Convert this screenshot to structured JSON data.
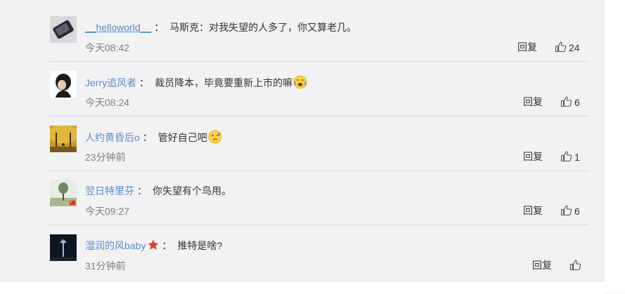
{
  "comments": [
    {
      "username": "__helloworld__",
      "text": "马斯克：对我失望的人多了，你又算老几。",
      "time": "今天08:42",
      "reply_label": "回复",
      "likes": "24",
      "avatar_icon": "phone-avatar-icon"
    },
    {
      "username": "Jerry追风者",
      "text": "裁员降本，毕竟要重新上市的嘛",
      "time": "今天08:24",
      "reply_label": "回复",
      "likes": "6",
      "emoji": "crying-laughing-emoji-icon",
      "avatar_icon": "profile-portrait-avatar-icon"
    },
    {
      "username": "人约黄昏后o",
      "text": "管好自己吧",
      "time": "23分钟前",
      "reply_label": "回复",
      "likes": "1",
      "emoji": "sweat-emoji-icon",
      "avatar_icon": "autumn-trees-avatar-icon"
    },
    {
      "username": "翌日特里芬",
      "text": "你失望有个鸟用。",
      "time": "今天09:27",
      "reply_label": "回复",
      "likes": "6",
      "avatar_icon": "tree-landscape-avatar-icon"
    },
    {
      "username": "湿润的风baby",
      "text": "推特是啥?",
      "time": "31分钟前",
      "reply_label": "回复",
      "likes": "",
      "badge": "red-star-badge-icon",
      "avatar_icon": "night-lamp-avatar-icon"
    }
  ],
  "colors": {
    "username": "#5b8bc9",
    "background": "#f2f2f5",
    "separator": "#d9d9d9",
    "time": "#808080"
  }
}
